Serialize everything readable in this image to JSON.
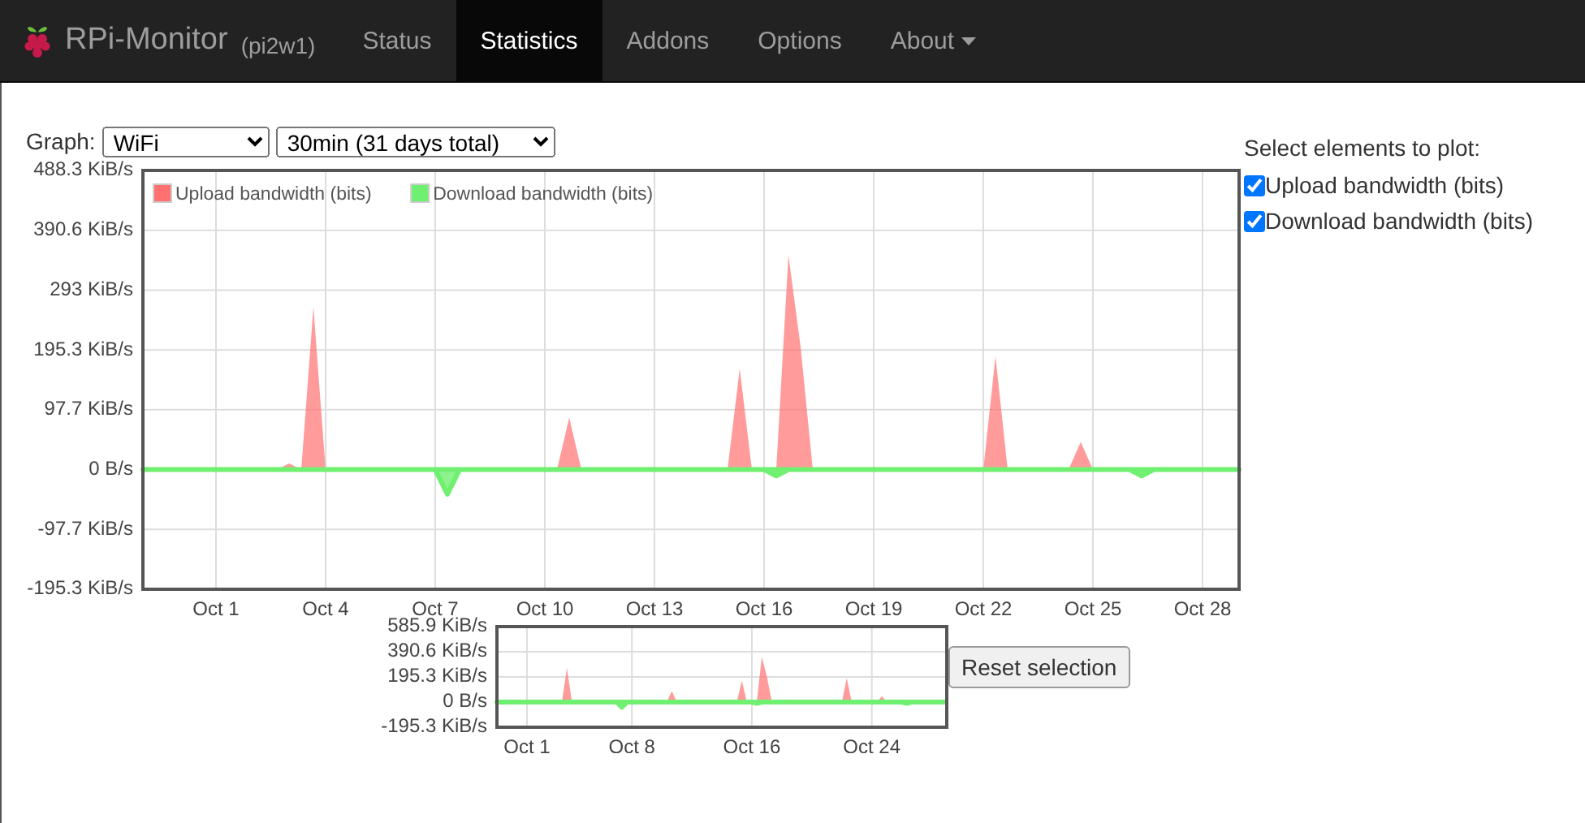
{
  "navbar": {
    "brand": "RPi-Monitor",
    "host": "(pi2w1)",
    "items": [
      {
        "label": "Status",
        "selected": false,
        "dropdown": false
      },
      {
        "label": "Statistics",
        "selected": true,
        "dropdown": false
      },
      {
        "label": "Addons",
        "selected": false,
        "dropdown": false
      },
      {
        "label": "Options",
        "selected": false,
        "dropdown": false
      },
      {
        "label": "About",
        "selected": false,
        "dropdown": true
      }
    ]
  },
  "controls": {
    "graph_label": "Graph:",
    "graph_select": "WiFi",
    "period_select": "30min (31 days total)"
  },
  "main_chart": {
    "chart_data": {
      "type": "area",
      "ylim": [
        -195.3,
        488.3
      ],
      "grid": true,
      "legend": true,
      "categories": [
        null,
        null,
        null,
        null,
        null,
        null,
        "Oct 1",
        null,
        null,
        null,
        null,
        null,
        null,
        null,
        null,
        "Oct 4",
        null,
        null,
        null,
        null,
        null,
        null,
        null,
        null,
        "Oct 7",
        null,
        null,
        null,
        null,
        null,
        null,
        null,
        null,
        "Oct 10",
        null,
        null,
        null,
        null,
        null,
        null,
        null,
        null,
        "Oct 13",
        null,
        null,
        null,
        null,
        null,
        null,
        null,
        null,
        "Oct 16",
        null,
        null,
        null,
        null,
        null,
        null,
        null,
        null,
        "Oct 19",
        null,
        null,
        null,
        null,
        null,
        null,
        null,
        null,
        "Oct 22",
        null,
        null,
        null,
        null,
        null,
        null,
        null,
        null,
        "Oct 25",
        null,
        null,
        null,
        null,
        null,
        null,
        null,
        null,
        "Oct 28",
        null,
        null,
        null
      ],
      "series": [
        {
          "name": "Upload bandwidth (bits)",
          "color": "#ff7070",
          "values": [
            0,
            0,
            0,
            0,
            0,
            0,
            0,
            0,
            0,
            0,
            0,
            0,
            10,
            0,
            265,
            0,
            0,
            0,
            0,
            0,
            0,
            0,
            0,
            0,
            0,
            0,
            0,
            0,
            0,
            0,
            0,
            0,
            0,
            0,
            0,
            85,
            0,
            0,
            0,
            0,
            0,
            0,
            0,
            0,
            0,
            0,
            0,
            0,
            0,
            165,
            0,
            0,
            0,
            350,
            200,
            0,
            0,
            0,
            0,
            0,
            0,
            0,
            0,
            0,
            0,
            0,
            0,
            0,
            0,
            0,
            185,
            0,
            0,
            0,
            0,
            0,
            0,
            45,
            0,
            0,
            0,
            0,
            0,
            0,
            0,
            0,
            0,
            0,
            0,
            0,
            0
          ]
        },
        {
          "name": "Download bandwidth (bits)",
          "color": "#70f070",
          "values": [
            0,
            0,
            0,
            0,
            0,
            0,
            0,
            0,
            0,
            0,
            0,
            0,
            0,
            0,
            0,
            0,
            0,
            0,
            0,
            0,
            0,
            0,
            0,
            0,
            0,
            -40,
            0,
            0,
            0,
            0,
            0,
            0,
            0,
            0,
            0,
            0,
            0,
            0,
            0,
            0,
            0,
            0,
            0,
            0,
            0,
            0,
            0,
            0,
            0,
            0,
            0,
            0,
            -10,
            0,
            0,
            0,
            0,
            0,
            0,
            0,
            0,
            0,
            0,
            0,
            0,
            0,
            0,
            0,
            0,
            0,
            0,
            0,
            0,
            0,
            0,
            0,
            0,
            0,
            0,
            0,
            0,
            0,
            -10,
            0,
            0,
            0,
            0,
            0,
            0,
            0,
            0
          ]
        }
      ],
      "yticks": [
        {
          "value": 488.3,
          "label": "488.3 KiB/s"
        },
        {
          "value": 390.6,
          "label": "390.6 KiB/s"
        },
        {
          "value": 293,
          "label": "293 KiB/s"
        },
        {
          "value": 195.3,
          "label": "195.3 KiB/s"
        },
        {
          "value": 97.7,
          "label": "97.7 KiB/s"
        },
        {
          "value": 0,
          "label": "0 B/s"
        },
        {
          "value": -97.7,
          "label": "-97.7 KiB/s"
        },
        {
          "value": -195.3,
          "label": "-195.3 KiB/s"
        }
      ]
    }
  },
  "overview_chart": {
    "chart_data": {
      "type": "area",
      "ylim": [
        -195.3,
        585.9
      ],
      "grid": true,
      "categories": [
        null,
        null,
        null,
        null,
        null,
        null,
        "Oct 1",
        null,
        null,
        null,
        null,
        null,
        null,
        null,
        null,
        null,
        null,
        null,
        null,
        null,
        null,
        null,
        null,
        null,
        null,
        null,
        null,
        "Oct 8",
        null,
        null,
        null,
        null,
        null,
        null,
        null,
        null,
        null,
        null,
        null,
        null,
        null,
        null,
        null,
        null,
        null,
        null,
        null,
        null,
        null,
        null,
        null,
        "Oct 16",
        null,
        null,
        null,
        null,
        null,
        null,
        null,
        null,
        null,
        null,
        null,
        null,
        null,
        null,
        null,
        null,
        null,
        null,
        null,
        null,
        null,
        null,
        null,
        "Oct 24",
        null,
        null,
        null,
        null,
        null,
        null,
        null,
        null,
        null,
        null,
        null,
        null,
        null,
        null,
        null
      ],
      "series": [
        {
          "color": "#ff7070",
          "values": [
            0,
            0,
            0,
            0,
            0,
            0,
            0,
            0,
            0,
            0,
            0,
            0,
            10,
            0,
            265,
            0,
            0,
            0,
            0,
            0,
            0,
            0,
            0,
            0,
            0,
            0,
            0,
            0,
            0,
            0,
            0,
            0,
            0,
            0,
            0,
            85,
            0,
            0,
            0,
            0,
            0,
            0,
            0,
            0,
            0,
            0,
            0,
            0,
            0,
            165,
            0,
            0,
            0,
            350,
            200,
            0,
            0,
            0,
            0,
            0,
            0,
            0,
            0,
            0,
            0,
            0,
            0,
            0,
            0,
            0,
            185,
            0,
            0,
            0,
            0,
            0,
            0,
            45,
            0,
            0,
            0,
            0,
            0,
            0,
            0,
            0,
            0,
            0,
            0,
            0,
            0
          ]
        },
        {
          "color": "#70f070",
          "values": [
            0,
            0,
            0,
            0,
            0,
            0,
            0,
            0,
            0,
            0,
            0,
            0,
            0,
            0,
            0,
            0,
            0,
            0,
            0,
            0,
            0,
            0,
            0,
            0,
            0,
            -40,
            0,
            0,
            0,
            0,
            0,
            0,
            0,
            0,
            0,
            0,
            0,
            0,
            0,
            0,
            0,
            0,
            0,
            0,
            0,
            0,
            0,
            0,
            0,
            0,
            0,
            0,
            -10,
            0,
            0,
            0,
            0,
            0,
            0,
            0,
            0,
            0,
            0,
            0,
            0,
            0,
            0,
            0,
            0,
            0,
            0,
            0,
            0,
            0,
            0,
            0,
            0,
            0,
            0,
            0,
            0,
            0,
            -10,
            0,
            0,
            0,
            0,
            0,
            0,
            0,
            0
          ]
        }
      ],
      "yticks": [
        {
          "value": 585.9,
          "label": "585.9 KiB/s"
        },
        {
          "value": 390.6,
          "label": "390.6 KiB/s"
        },
        {
          "value": 195.3,
          "label": "195.3 KiB/s"
        },
        {
          "value": 0,
          "label": "0 B/s"
        },
        {
          "value": -195.3,
          "label": "-195.3 KiB/s"
        }
      ]
    }
  },
  "reset_button": "Reset selection",
  "plot_selector": {
    "title": "Select elements to plot:",
    "items": [
      {
        "label": "Upload bandwidth (bits)",
        "checked": true
      },
      {
        "label": "Download bandwidth (bits)",
        "checked": true
      }
    ]
  }
}
